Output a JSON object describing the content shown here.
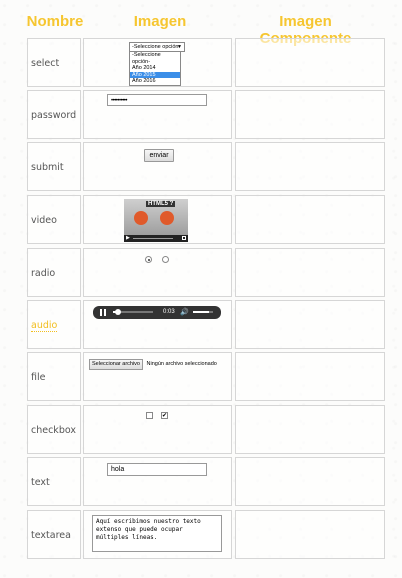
{
  "headers": {
    "nombre": "Nombre",
    "imagen": "Imagen",
    "componente": "Imagen Componente"
  },
  "rows": [
    {
      "label": "select"
    },
    {
      "label": "password"
    },
    {
      "label": "submit"
    },
    {
      "label": "video"
    },
    {
      "label": "radio"
    },
    {
      "label": "audio"
    },
    {
      "label": "file"
    },
    {
      "label": "checkbox"
    },
    {
      "label": "text"
    },
    {
      "label": "textarea"
    }
  ],
  "select": {
    "value": "-Seleccione opción-",
    "options": [
      "-Seleccione opción-",
      "Año 2014",
      "Año 2015",
      "Año 2016"
    ],
    "highlighted": "Año 2015"
  },
  "password": {
    "value": "••••••••••"
  },
  "submit": {
    "label": "enviar"
  },
  "video": {
    "poster_text": "HTML5 ?"
  },
  "radio": {
    "checked_index": 0
  },
  "audio": {
    "time": "0:03",
    "progress": 0.12,
    "volume": 0.8
  },
  "file": {
    "button": "Seleccionar archivo",
    "status": "Ningún archivo seleccionado"
  },
  "checkbox": {
    "checked": [
      false,
      true
    ]
  },
  "text": {
    "value": "hola"
  },
  "textarea": {
    "value": "Aquí escribimos nuestro texto extenso que puede ocupar múltiples líneas."
  },
  "colors": {
    "header": "#f6c630",
    "highlight": "#3b8ee8",
    "audio_bg": "#333333"
  }
}
